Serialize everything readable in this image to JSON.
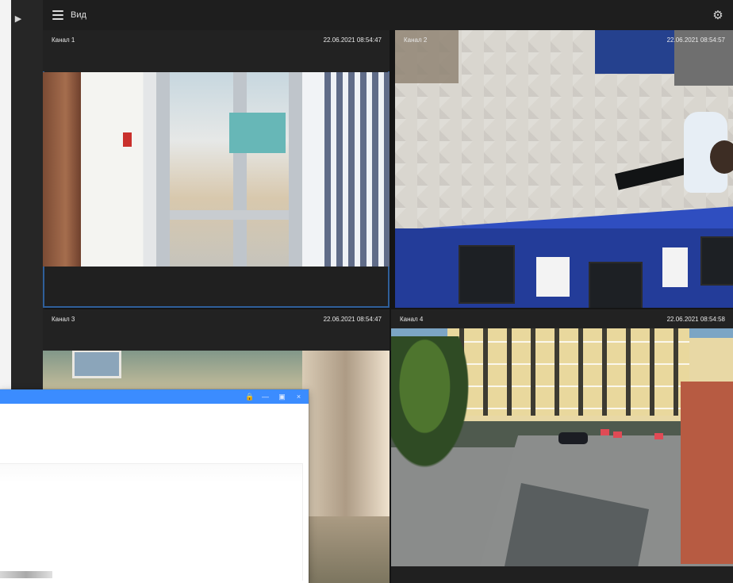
{
  "toolbar": {
    "view_label": "Вид",
    "sidebar_toggle_icon": "play-icon",
    "menu_icon": "menu-icon",
    "settings_icon": "settings-icon"
  },
  "cameras": [
    {
      "title": "Канал 1",
      "timestamp": "22.06.2021 08:54:47"
    },
    {
      "title": "Канал 2",
      "timestamp": "22.06.2021 08:54:57"
    },
    {
      "title": "Канал 3",
      "timestamp": "22.06.2021 08:54:47"
    },
    {
      "title": "Канал 4",
      "timestamp": "22.06.2021 08:54:58"
    }
  ],
  "dialog": {
    "controls": [
      "lock-icon",
      "minimize-icon",
      "maximize-icon",
      "close-icon"
    ]
  },
  "colors": {
    "app_background": "#151515",
    "selected_tile": "#2f5f9a",
    "dialog_titlebar": "#3b8cff"
  }
}
